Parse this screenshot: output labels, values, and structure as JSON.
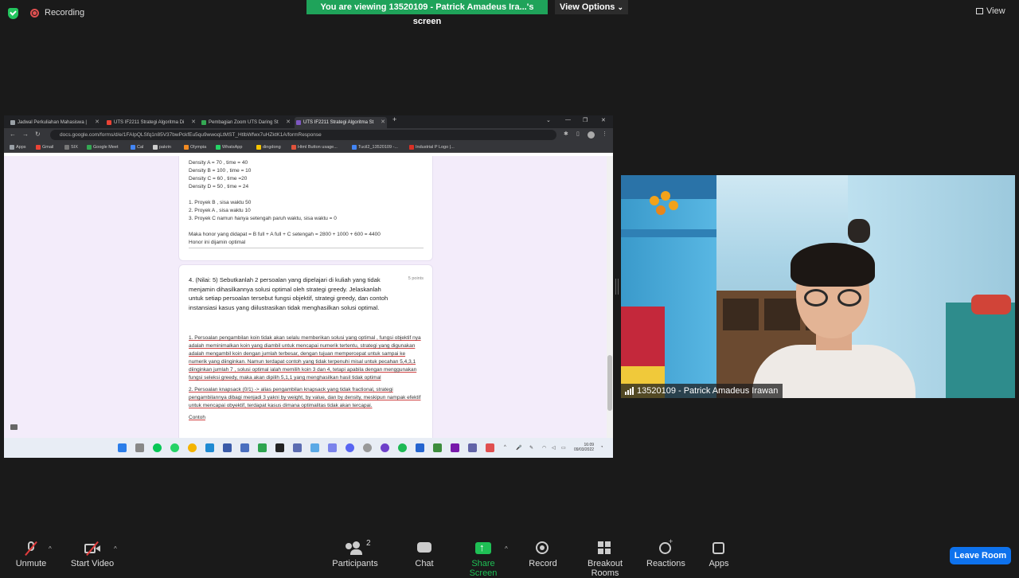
{
  "top": {
    "recording_label": "Recording",
    "viewing_banner": "You are viewing 13520109 - Patrick Amadeus Ira...'s screen",
    "view_options": "View Options",
    "view_options_caret": "⌄",
    "view_label": "View",
    "banner_color": "#1fa35a"
  },
  "browser": {
    "tabs": [
      {
        "title": "Jadwal Perkuliahan Mahasiswa |",
        "active": false
      },
      {
        "title": "UTS IF2211 Strategi Algoritma Di",
        "active": false
      },
      {
        "title": "Pembagian Zoom UTS Daring St",
        "active": false
      },
      {
        "title": "UTS IF2211 Strategi Algoritma St",
        "active": true
      }
    ],
    "new_tab": "+",
    "url": "docs.google.com/forms/d/e/1FAIpQLSfq1n85V37bwPckfEu5qu9wwoqLtMST_HtlbWfwx7uHZktK1A/formResponse",
    "bookmarks": [
      {
        "label": "Apps",
        "color": "#9aa0a6"
      },
      {
        "label": "Gmail",
        "color": "#ea4335"
      },
      {
        "label": "SIX",
        "color": "#777"
      },
      {
        "label": "Google Meet",
        "color": "#34a853"
      },
      {
        "label": "Cal",
        "color": "#4285f4"
      },
      {
        "label": "pakrin",
        "color": "#ccc"
      },
      {
        "label": "Olympia",
        "color": "#f28b22"
      },
      {
        "label": "WhatsApp",
        "color": "#25d366"
      },
      {
        "label": "dingdong",
        "color": "#f5c400"
      },
      {
        "label": "Html Button usage...",
        "color": "#e0533b"
      },
      {
        "label": "Tucil2_13520109 -...",
        "color": "#4285f4"
      },
      {
        "label": "Industrial P Logo |...",
        "color": "#d93025"
      }
    ]
  },
  "form": {
    "card1_lines": [
      "Density A = 70 , time = 40",
      "Density B = 100 , time = 10",
      "Density C = 60 , time =20",
      "Density D = 50 , time = 24",
      "",
      "1. Proyek B , sisa waktu 50",
      "2. Proyek A , sisa waktu 10",
      "3. Proyek C namun hanya setengah paruh waktu, sisa waktu = 0",
      "",
      "Maka honor yang didapat = B full + A full + C setengah = 2800 + 1000 + 600 = 4400",
      "Honor ini dijamin optimal"
    ],
    "question": "4. (Nilai: 5) Sebutkanlah 2 persoalan yang dipelajari di kuliah yang tidak menjamin dihasilkannya solusi optimal oleh strategi greedy. Jelaskanlah untuk setiap persoalan tersebut fungsi objektif, strategi greedy, dan contoh instansiasi kasus yang diilustrasikan tidak menghasilkan solusi optimal.",
    "points": "5 points",
    "answer_p1": "1. Persoalan pengambilan koin tidak akan selalu memberikan solusi yang optimal , fungsi objektif nya adalah meminimalkan koin yang diambil untuk mencapai numerik tertentu, strategi yang digunakan adalah mengambil koin dengan jumlah terbesar, dengan tujuan mempercepat untuk sampai ke numerik yang diinginkan. Namun terdapat contoh yang tidak terpenuhi misal untuk pecahan 5,4,3,1 diinginkan jumlah 7 , solusi optimal ialah memilih koin 3 dan 4, tetapi apabila dengan menggunakan fungsi seleksi greedy, maka akan dipilih 5,1,1 yang menghasilkan hasil tidak optimal",
    "answer_p2": "2. Persoalan knapsack (0/1) -> alias pengambilan knapsack yang tidak fractional, strategi pengambilannya dibagi menjadi 3 yakni by weight, by value, dan by density, meskipun nampak efektif untuk mencapai obyektif, terdapat kasus dimana optimalitas tidak akan tercapai.",
    "answer_p3": "Contoh"
  },
  "taskbar": {
    "time": "16:09",
    "date": "09/03/2022",
    "icons": [
      "windows-icon",
      "search-icon",
      "line-icon",
      "whatsapp-icon",
      "chrome-icon",
      "vscode-icon",
      "app-icon",
      "app-icon",
      "app-icon",
      "notion-icon",
      "app-icon",
      "app-icon",
      "app-icon",
      "teams-icon",
      "discord-icon",
      "app-icon",
      "github-icon",
      "app-icon",
      "spotify-icon",
      "todo-icon",
      "app-icon",
      "onenote-icon",
      "app-icon",
      "app-icon"
    ]
  },
  "video": {
    "participant_name": "13520109 - Patrick Amadeus Irawan"
  },
  "controls": {
    "unmute": "Unmute",
    "start_video": "Start Video",
    "participants": "Participants",
    "participants_count": "2",
    "chat": "Chat",
    "share_screen": "Share Screen",
    "record": "Record",
    "breakout_rooms": "Breakout Rooms",
    "reactions": "Reactions",
    "apps": "Apps",
    "leave_room": "Leave Room",
    "caret": "^",
    "share_color": "#1fbf55",
    "leave_color": "#0e72ed"
  }
}
